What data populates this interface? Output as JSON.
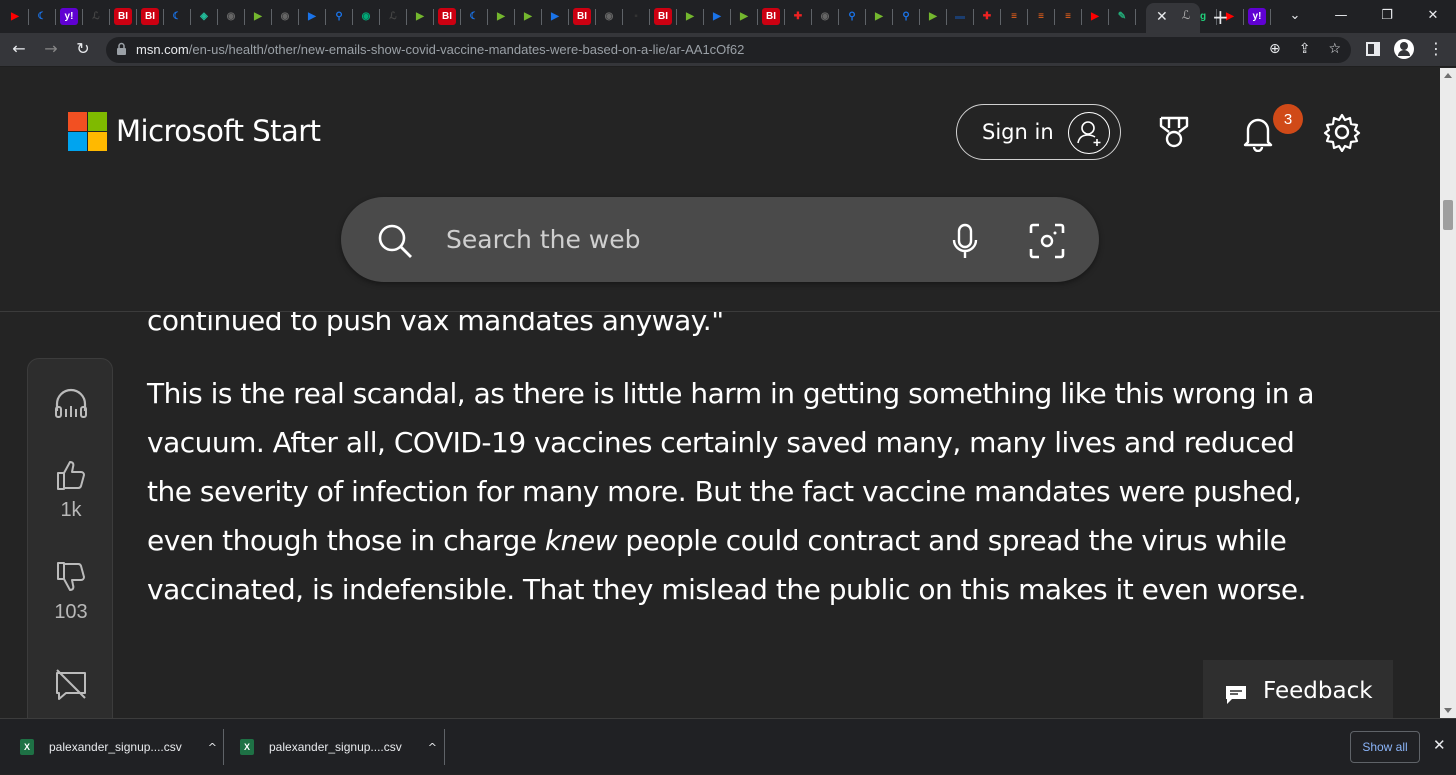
{
  "browser": {
    "favicons": [
      {
        "name": "youtube-icon",
        "color": "#ff0000",
        "glyph": "▶"
      },
      {
        "name": "bookmark-icon",
        "color": "#1a73e8",
        "glyph": "☾"
      },
      {
        "name": "yahoo-icon",
        "color": "#6001d2",
        "glyph": "y!"
      },
      {
        "name": "site-icon",
        "color": "#444",
        "glyph": "ℒ"
      },
      {
        "name": "bi-icon",
        "color": "#c01",
        "glyph": "BI"
      },
      {
        "name": "bi-icon",
        "color": "#c01",
        "glyph": "BI"
      },
      {
        "name": "bookmark-icon",
        "color": "#1a73e8",
        "glyph": "☾"
      },
      {
        "name": "site-icon",
        "color": "#2b9",
        "glyph": "◈"
      },
      {
        "name": "globe-icon",
        "color": "#666",
        "glyph": "◉"
      },
      {
        "name": "rumble-icon",
        "color": "#74b72e",
        "glyph": "▶"
      },
      {
        "name": "globe-icon",
        "color": "#666",
        "glyph": "◉"
      },
      {
        "name": "site-icon",
        "color": "#1a73e8",
        "glyph": "▶"
      },
      {
        "name": "search-icon",
        "color": "#1a73e8",
        "glyph": "⚲"
      },
      {
        "name": "globe-icon",
        "color": "#0a7",
        "glyph": "◉"
      },
      {
        "name": "site-icon",
        "color": "#444",
        "glyph": "ℒ"
      },
      {
        "name": "rumble-icon",
        "color": "#74b72e",
        "glyph": "▶"
      },
      {
        "name": "bi-icon",
        "color": "#c01",
        "glyph": "BI"
      },
      {
        "name": "bookmark-icon",
        "color": "#1a73e8",
        "glyph": "☾"
      },
      {
        "name": "rumble-icon",
        "color": "#74b72e",
        "glyph": "▶"
      },
      {
        "name": "rumble-icon",
        "color": "#74b72e",
        "glyph": "▶"
      },
      {
        "name": "site-icon",
        "color": "#1a73e8",
        "glyph": "▶"
      },
      {
        "name": "bi-icon",
        "color": "#c01",
        "glyph": "BI"
      },
      {
        "name": "globe-icon",
        "color": "#666",
        "glyph": "◉"
      },
      {
        "name": "site-icon",
        "color": "#333",
        "glyph": "▪"
      },
      {
        "name": "bi-icon",
        "color": "#c01",
        "glyph": "BI"
      },
      {
        "name": "rumble-icon",
        "color": "#74b72e",
        "glyph": "▶"
      },
      {
        "name": "site-icon",
        "color": "#1a73e8",
        "glyph": "▶"
      },
      {
        "name": "rumble-icon",
        "color": "#74b72e",
        "glyph": "▶"
      },
      {
        "name": "bi-icon",
        "color": "#c01",
        "glyph": "BI"
      },
      {
        "name": "site-icon",
        "color": "#e22",
        "glyph": "✚"
      },
      {
        "name": "globe-icon",
        "color": "#666",
        "glyph": "◉"
      },
      {
        "name": "search-icon",
        "color": "#1a73e8",
        "glyph": "⚲"
      },
      {
        "name": "rumble-icon",
        "color": "#74b72e",
        "glyph": "▶"
      },
      {
        "name": "search-icon",
        "color": "#1a73e8",
        "glyph": "⚲"
      },
      {
        "name": "rumble-icon",
        "color": "#74b72e",
        "glyph": "▶"
      },
      {
        "name": "site-icon",
        "color": "#1b3d6e",
        "glyph": "▬"
      },
      {
        "name": "site-icon",
        "color": "#e22",
        "glyph": "✚"
      },
      {
        "name": "substack-icon",
        "color": "#ff6719",
        "glyph": "≡"
      },
      {
        "name": "substack-icon",
        "color": "#ff6719",
        "glyph": "≡"
      },
      {
        "name": "substack-icon",
        "color": "#ff6719",
        "glyph": "≡"
      },
      {
        "name": "youtube-icon",
        "color": "#ff0000",
        "glyph": "▶"
      },
      {
        "name": "site-icon",
        "color": "#2a7",
        "glyph": "✎"
      },
      {
        "name": "search-icon",
        "color": "#1a73e8",
        "glyph": "⚲"
      },
      {
        "name": "globe-icon",
        "color": "#666",
        "glyph": "◉"
      },
      {
        "name": "gab-icon",
        "color": "#21cf7a",
        "glyph": "g"
      },
      {
        "name": "youtube-icon",
        "color": "#ff0000",
        "glyph": "▶"
      },
      {
        "name": "yahoo-icon",
        "color": "#6001d2",
        "glyph": "y!"
      }
    ],
    "after_tab_favicon": "ℒ",
    "url_domain": "msn.com",
    "url_path": "/en-us/health/other/new-emails-show-covid-vaccine-mandates-were-based-on-a-lie/ar-AA1cOf62"
  },
  "header": {
    "brand": "Microsoft Start",
    "sign_in": "Sign in",
    "notification_count": "3",
    "search_placeholder": "Search the web",
    "logo_colors": [
      "#f25022",
      "#7fba00",
      "#00a4ef",
      "#ffb900"
    ]
  },
  "article": {
    "previous_line": "continued to push vax mandates anyway.\"",
    "para_before": "This is the real scandal, as there is little harm in getting something like this wrong in a vacuum. After all, COVID-19 vaccines certainly saved many, many lives and reduced the severity of infection for many more. But the fact vaccine mandates were pushed, even though those in charge ",
    "para_emph": "knew",
    "para_after": " people could contract and spread the virus while vaccinated, is indefensible. That they mislead the public on this makes it even worse."
  },
  "actions": {
    "likes": "1k",
    "dislikes": "103"
  },
  "feedback": {
    "label": "Feedback"
  },
  "downloads": {
    "items": [
      "palexander_signup....csv",
      "palexander_signup....csv"
    ],
    "show_all": "Show all"
  }
}
